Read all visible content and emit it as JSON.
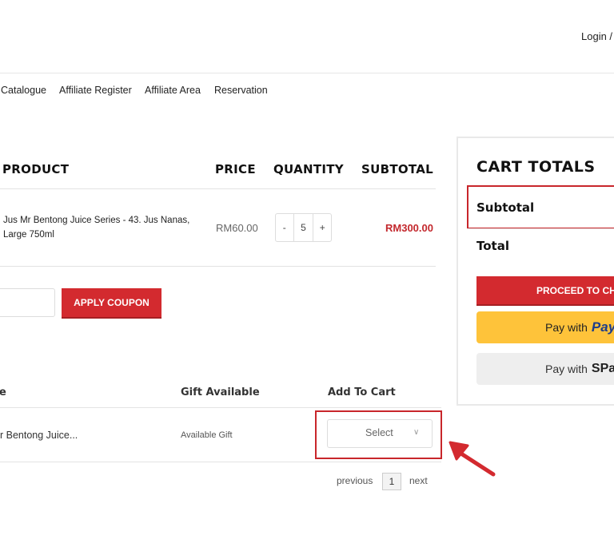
{
  "header": {
    "login_label": "Login /"
  },
  "nav": {
    "items": [
      "Catalogue",
      "Affiliate Register",
      "Affiliate Area",
      "Reservation"
    ]
  },
  "cart_table": {
    "headers": {
      "product": "PRODUCT",
      "price": "PRICE",
      "quantity": "QUANTITY",
      "subtotal": "SUBTOTAL"
    },
    "rows": [
      {
        "name": "Jus Mr Bentong Juice Series - 43. Jus Nanas, Large 750ml",
        "price": "RM60.00",
        "qty_minus": "-",
        "quantity": "5",
        "qty_plus": "+",
        "subtotal": "RM300.00"
      }
    ]
  },
  "coupon": {
    "placeholder": "",
    "apply_label": "APPLY COUPON"
  },
  "gift_table": {
    "headers": {
      "name": "e",
      "gift": "Gift Available",
      "add": "Add To Cart"
    },
    "rows": [
      {
        "product": "r Bentong Juice...",
        "gift": "Available Gift",
        "select": "Select"
      }
    ]
  },
  "pagination": {
    "previous": "previous",
    "current": "1",
    "next": "next"
  },
  "cart_totals": {
    "title": "CART TOTALS",
    "subtotal_label": "Subtotal",
    "total_label": "Total",
    "checkout_label": "PROCEED TO CHECKOUT",
    "paypal_prefix": "Pay with",
    "paypal_brand": "PayPal",
    "paylater_prefix": "Pay with",
    "paylater_brand": "SPayLater"
  },
  "colors": {
    "accent_red": "#d32a2f",
    "highlight_red": "#c8262b",
    "paypal_yellow": "#fec33a",
    "paypal_blue": "#1d3d8b"
  }
}
